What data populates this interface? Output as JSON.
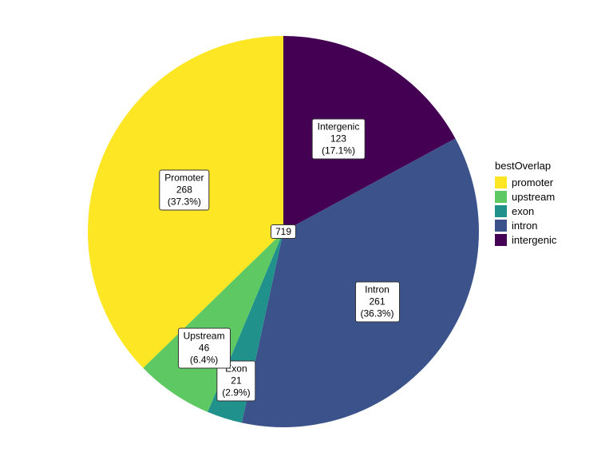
{
  "chart_data": {
    "type": "pie",
    "total_label": "719",
    "legend_title": "bestOverlap",
    "series": [
      {
        "key": "promoter",
        "display": "Promoter",
        "legend": "promoter",
        "value": 268,
        "percent": "37.3%",
        "color": "#fde725"
      },
      {
        "key": "upstream",
        "display": "Upstream",
        "legend": "upstream",
        "value": 46,
        "percent": "6.4%",
        "color": "#5ec962"
      },
      {
        "key": "exon",
        "display": "Exon",
        "legend": "exon",
        "value": 21,
        "percent": "2.9%",
        "color": "#21918c"
      },
      {
        "key": "intron",
        "display": "Intron",
        "legend": "intron",
        "value": 261,
        "percent": "36.3%",
        "color": "#3b528b"
      },
      {
        "key": "intergenic",
        "display": "Intergenic",
        "legend": "intergenic",
        "value": 123,
        "percent": "17.1%",
        "color": "#440154"
      }
    ],
    "label_radius_factor": {
      "promoter": 0.55,
      "upstream": 0.72,
      "exon": 0.8,
      "intron": 0.6,
      "intergenic": 0.55
    }
  },
  "geometry": {
    "cx": 355,
    "cy": 290,
    "r": 245
  }
}
